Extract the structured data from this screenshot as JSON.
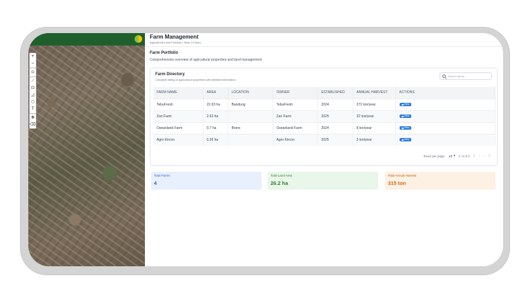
{
  "header": {
    "title": "Farm Management",
    "subtitle": "Agricultural Land Portfolio | Total: 4 Farms"
  },
  "portfolio": {
    "title": "Farm Portfolio",
    "description": "Comprehensive overview of agricultural properties and land management"
  },
  "directory": {
    "title": "Farm Directory",
    "subtitle": "Complete listing of agricultural properties with detailed information",
    "search_placeholder": "Search farms...",
    "columns": [
      "FARM NAME",
      "AREA",
      "LOCATION",
      "OWNER",
      "ESTABLISHED",
      "ANNUAL HARVEST",
      "ACTIONS"
    ],
    "rows": [
      {
        "name": "TebuFresh",
        "area": "22.63 ha",
        "location": "Bandung",
        "owner": "TebuFresh",
        "established": "2024",
        "harvest": "272 ton/year",
        "action": "View"
      },
      {
        "name": "Zan Farm",
        "area": "2.63 ha",
        "location": "",
        "owner": "Zan Farm",
        "established": "2025",
        "harvest": "32 ton/year",
        "action": "View"
      },
      {
        "name": "Oseanland Farm",
        "area": "0.7 ha",
        "location": "Bronx",
        "owner": "Oseanland Farm",
        "established": "2024",
        "harvest": "8 ton/year",
        "action": "View"
      },
      {
        "name": "Agro Kircon",
        "area": "0.26 ha",
        "location": "",
        "owner": "Agro Kircon",
        "established": "2025",
        "harvest": "3 ton/year",
        "action": "View"
      }
    ],
    "pagination": {
      "rows_per_page_label": "Rows per page:",
      "rows_per_page": "10",
      "range": "1–4 of 4"
    }
  },
  "stats": {
    "total_farms_label": "Total Farms",
    "total_farms": "4",
    "total_land_label": "Total Land Area",
    "total_land": "26.2 ha",
    "total_harvest_label": "Total Annual Harvest",
    "total_harvest": "315 ton"
  },
  "colors": {
    "accent_blue": "#2f7de1",
    "map_header_green": "#1f5f2c",
    "stat_blue": "#2f62c9",
    "stat_green": "#2e7d32",
    "stat_orange": "#e0660a"
  },
  "map_tools": [
    "zoom-in-icon",
    "zoom-out-icon",
    "target-icon",
    "line-icon",
    "square-icon",
    "polygon-icon",
    "circle-icon",
    "text-icon",
    "move-icon",
    "eraser-icon"
  ]
}
